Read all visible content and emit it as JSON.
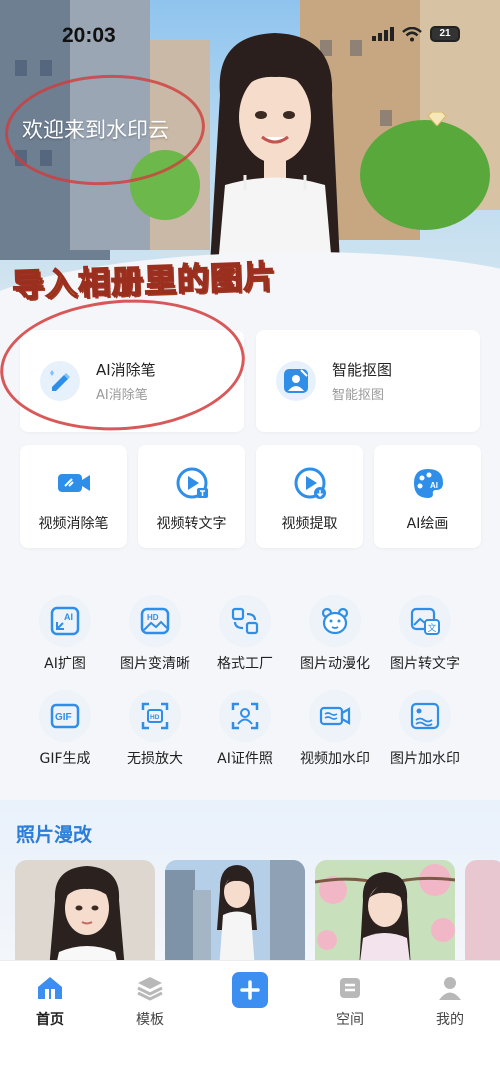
{
  "status_bar": {
    "time": "20:03",
    "battery": "21"
  },
  "hero": {
    "welcome": "欢迎来到水印云",
    "overlay_text": "导入相册里的图片"
  },
  "big_tools": [
    {
      "title": "AI消除笔",
      "subtitle": "AI消除笔",
      "icon": "eraser-pen-icon"
    },
    {
      "title": "智能抠图",
      "subtitle": "智能抠图",
      "icon": "smart-cutout-icon"
    }
  ],
  "medium_tools": [
    {
      "label": "视频消除笔",
      "icon": "video-eraser-icon"
    },
    {
      "label": "视频转文字",
      "icon": "video-to-text-icon"
    },
    {
      "label": "视频提取",
      "icon": "video-extract-icon"
    },
    {
      "label": "AI绘画",
      "icon": "ai-painting-icon"
    }
  ],
  "grid_tools_row1": [
    {
      "label": "AI扩图",
      "icon": "ai-expand-icon"
    },
    {
      "label": "图片变清晰",
      "icon": "hd-enhance-icon"
    },
    {
      "label": "格式工厂",
      "icon": "format-factory-icon"
    },
    {
      "label": "图片动漫化",
      "icon": "anime-bear-icon"
    },
    {
      "label": "图片转文字",
      "icon": "image-to-text-icon"
    }
  ],
  "grid_tools_row2": [
    {
      "label": "GIF生成",
      "icon": "gif-icon"
    },
    {
      "label": "无损放大",
      "icon": "lossless-upscale-icon"
    },
    {
      "label": "AI证件照",
      "icon": "id-photo-icon"
    },
    {
      "label": "视频加水印",
      "icon": "video-watermark-icon"
    },
    {
      "label": "图片加水印",
      "icon": "image-watermark-icon"
    }
  ],
  "photo_section": {
    "title": "照片漫改"
  },
  "tabbar": [
    {
      "label": "首页",
      "icon": "home-icon",
      "active": true
    },
    {
      "label": "模板",
      "icon": "layers-icon",
      "active": false
    },
    {
      "label": "",
      "icon": "plus-icon",
      "active": false
    },
    {
      "label": "空间",
      "icon": "space-icon",
      "active": false
    },
    {
      "label": "我的",
      "icon": "profile-icon",
      "active": false
    }
  ],
  "colors": {
    "accent": "#2a7dd8",
    "overlay_yellow": "#f5b819",
    "annotation_red": "#d23c3c"
  }
}
